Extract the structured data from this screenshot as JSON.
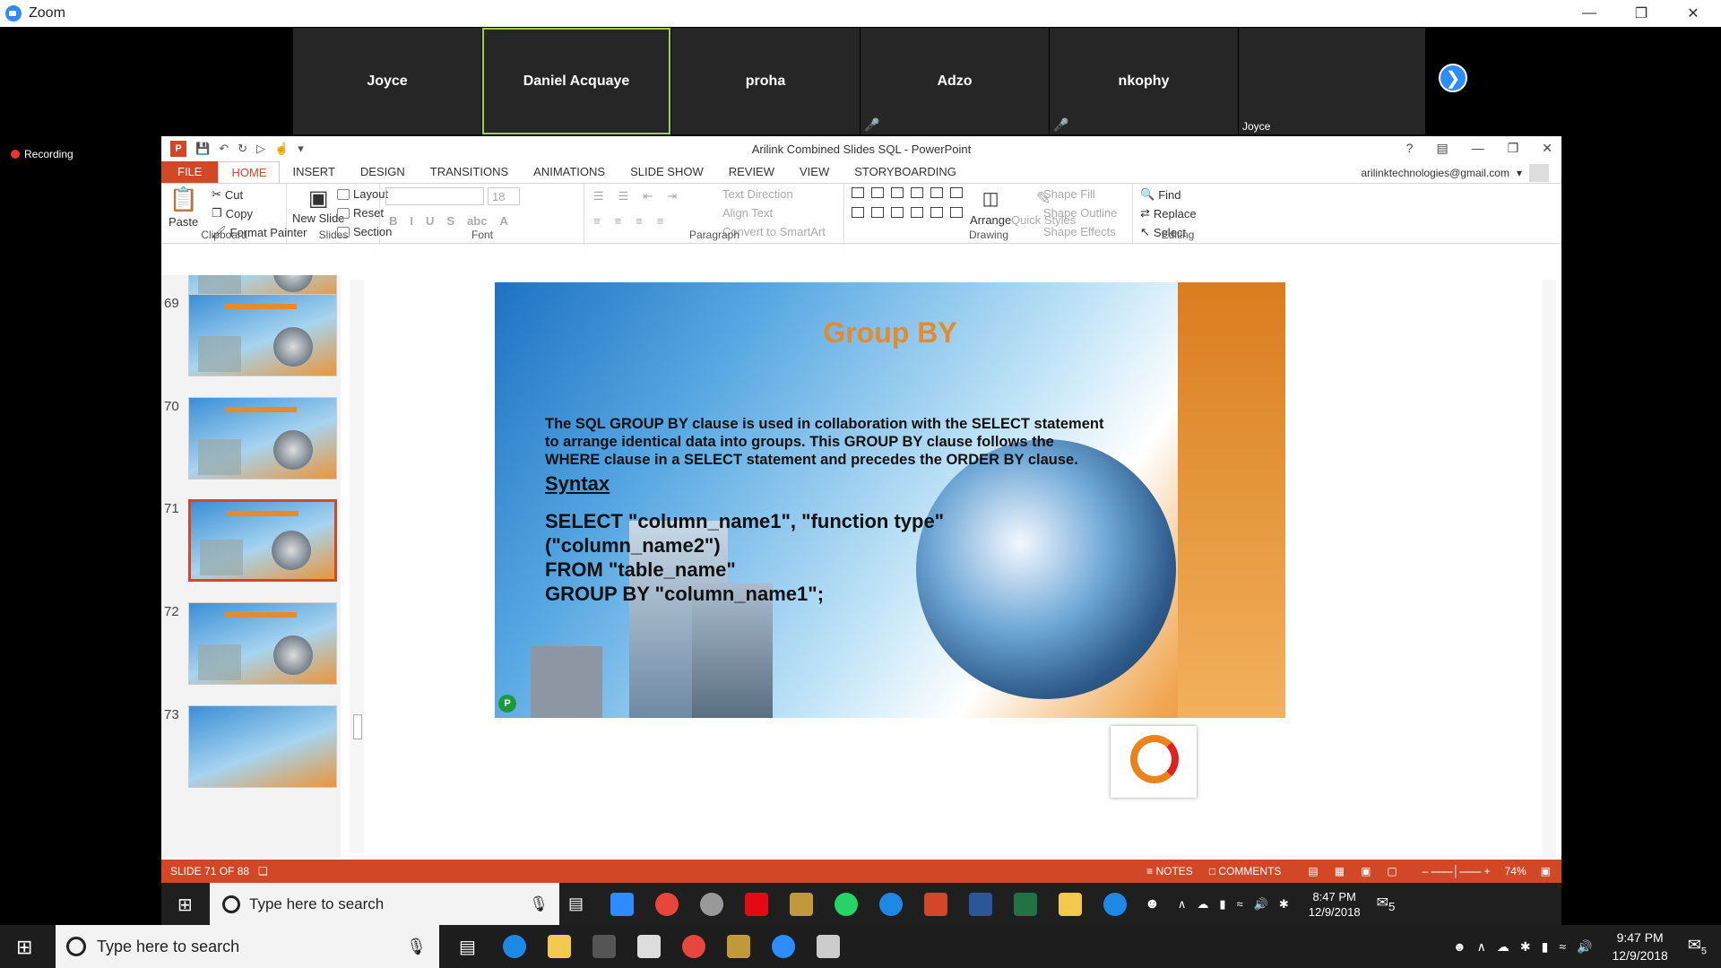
{
  "zoom": {
    "title": "Zoom",
    "recording": "Recording",
    "participants": [
      {
        "name": "Joyce",
        "active": false
      },
      {
        "name": "Daniel Acquaye",
        "active": true
      },
      {
        "name": "proha",
        "active": false
      },
      {
        "name": "Adzo",
        "active": false
      },
      {
        "name": "nkophy",
        "active": false
      },
      {
        "name": "",
        "caption": "Joyce",
        "active": false
      }
    ]
  },
  "ppt": {
    "window_title": "Arilink Combined Slides SQL - PowerPoint",
    "account": "arilinktechnologies@gmail.com",
    "tabs": [
      "FILE",
      "HOME",
      "INSERT",
      "DESIGN",
      "TRANSITIONS",
      "ANIMATIONS",
      "SLIDE SHOW",
      "REVIEW",
      "VIEW",
      "STORYBOARDING"
    ],
    "ribbon": {
      "clipboard": {
        "paste": "Paste",
        "cut": "Cut",
        "copy": "Copy",
        "format_painter": "Format Painter",
        "label": "Clipboard"
      },
      "slides": {
        "new_slide": "New Slide",
        "layout": "Layout",
        "reset": "Reset",
        "section": "Section",
        "label": "Slides"
      },
      "font": {
        "size": "18",
        "label": "Font"
      },
      "paragraph": {
        "text_direction": "Text Direction",
        "align_text": "Align Text",
        "smartart": "Convert to SmartArt",
        "label": "Paragraph"
      },
      "drawing": {
        "arrange": "Arrange",
        "quick_styles": "Quick Styles",
        "shape_fill": "Shape Fill",
        "shape_outline": "Shape Outline",
        "shape_effects": "Shape Effects",
        "label": "Drawing"
      },
      "editing": {
        "find": "Find",
        "replace": "Replace",
        "select": "Select",
        "label": "Editing"
      }
    },
    "thumbnails": [
      "69",
      "70",
      "71",
      "72",
      "73"
    ],
    "selected_slide": "71",
    "slide": {
      "title": "Group BY",
      "body": "The SQL GROUP BY clause is used in collaboration with the SELECT statement to arrange identical data into groups. This GROUP BY clause follows the WHERE clause in a SELECT statement and precedes the ORDER BY clause.",
      "syntax_heading": "Syntax",
      "code": [
        "SELECT \"column_name1\", \"function type\"",
        "(\"column_name2\")",
        "FROM \"table_name\"",
        "GROUP BY \"column_name1\";"
      ]
    },
    "status": {
      "slide": "SLIDE 71 OF 88",
      "notes": "NOTES",
      "comments": "COMMENTS",
      "zoom": "74%"
    }
  },
  "inner_taskbar": {
    "search": "Type here to search",
    "time": "8:47 PM",
    "date": "12/9/2018",
    "notifications": "5"
  },
  "outer_taskbar": {
    "search": "Type here to search",
    "time": "9:47 PM",
    "date": "12/9/2018",
    "notifications": "5"
  }
}
